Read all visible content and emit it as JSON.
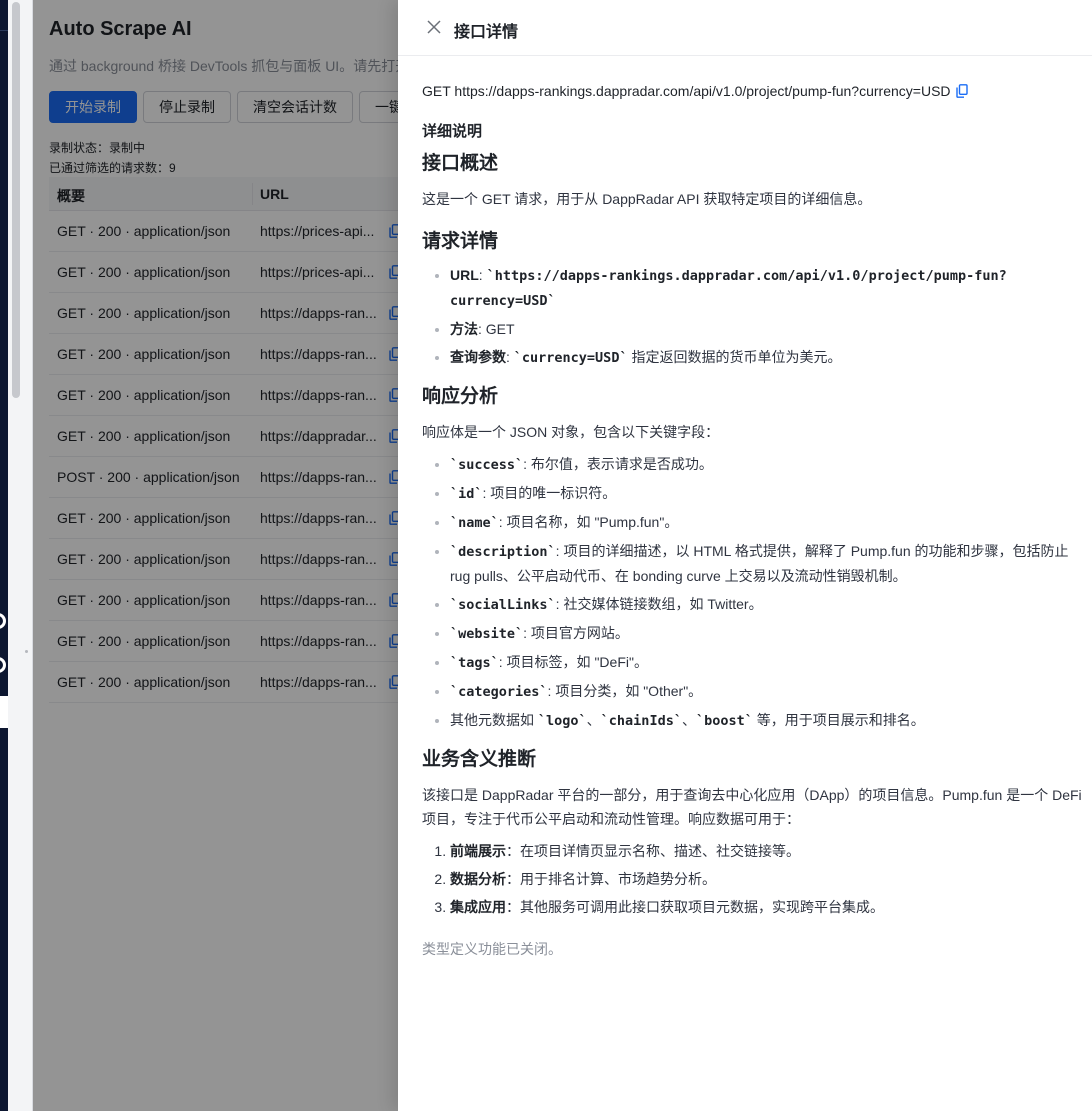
{
  "app": {
    "title": "Auto Scrape AI",
    "description": "通过 background 桥接 DevTools 抓包与面板 UI。请先打开"
  },
  "toolbar": {
    "start_label": "开始录制",
    "stop_label": "停止录制",
    "clear_label": "清空会话计数",
    "more_label": "一键"
  },
  "status": {
    "recording": "录制状态：录制中",
    "filtered": "已通过筛选的请求数：9"
  },
  "table": {
    "headers": [
      "概要",
      "URL"
    ],
    "rows": [
      {
        "summary": "GET · 200 · application/json",
        "url": "https://prices-api..."
      },
      {
        "summary": "GET · 200 · application/json",
        "url": "https://prices-api..."
      },
      {
        "summary": "GET · 200 · application/json",
        "url": "https://dapps-ran..."
      },
      {
        "summary": "GET · 200 · application/json",
        "url": "https://dapps-ran..."
      },
      {
        "summary": "GET · 200 · application/json",
        "url": "https://dapps-ran..."
      },
      {
        "summary": "GET · 200 · application/json",
        "url": "https://dappradar..."
      },
      {
        "summary": "POST · 200 · application/json",
        "url": "https://dapps-ran..."
      },
      {
        "summary": "GET · 200 · application/json",
        "url": "https://dapps-ran..."
      },
      {
        "summary": "GET · 200 · application/json",
        "url": "https://dapps-ran..."
      },
      {
        "summary": "GET · 200 · application/json",
        "url": "https://dapps-ran..."
      },
      {
        "summary": "GET · 200 · application/json",
        "url": "https://dapps-ran..."
      },
      {
        "summary": "GET · 200 · application/json",
        "url": "https://dapps-ran..."
      }
    ]
  },
  "drawer": {
    "title": "接口详情",
    "request_line": "GET https://dapps-rankings.dappradar.com/api/v1.0/project/pump-fun?currency=USD",
    "section_title": "详细说明",
    "h_overview": "接口概述",
    "p_overview": "这是一个 GET 请求，用于从 DappRadar API 获取特定项目的详细信息。",
    "h_request": "请求详情",
    "req_url_label": "URL",
    "req_url_sep": ": ",
    "req_url_code": "`https://dapps-rankings.dappradar.com/api/v1.0/project/pump-fun?currency=USD`",
    "req_method_label": "方法",
    "req_method_value": ": GET",
    "req_query_label": "查询参数",
    "req_query_sep": ": ",
    "req_query_code": "`currency=USD`",
    "req_query_desc": " 指定返回数据的货币单位为美元。",
    "h_response": "响应分析",
    "p_response": "响应体是一个 JSON 对象，包含以下关键字段：",
    "fields": [
      {
        "code": "`success`",
        "desc": ": 布尔值，表示请求是否成功。"
      },
      {
        "code": "`id`",
        "desc": ": 项目的唯一标识符。"
      },
      {
        "code": "`name`",
        "desc": ": 项目名称，如 \"Pump.fun\"。"
      },
      {
        "code": "`description`",
        "desc": ": 项目的详细描述，以 HTML 格式提供，解释了 Pump.fun 的功能和步骤，包括防止 rug pulls、公平启动代币、在 bonding curve 上交易以及流动性销毁机制。"
      },
      {
        "code": "`socialLinks`",
        "desc": ": 社交媒体链接数组，如 Twitter。"
      },
      {
        "code": "`website`",
        "desc": ": 项目官方网站。"
      },
      {
        "code": "`tags`",
        "desc": ": 项目标签，如 \"DeFi\"。"
      },
      {
        "code": "`categories`",
        "desc": ": 项目分类，如 \"Other\"。"
      }
    ],
    "other_prefix": "其他元数据如 ",
    "other_code1": "`logo`",
    "other_sep1": "、",
    "other_code2": "`chainIds`",
    "other_sep2": "、",
    "other_code3": "`boost`",
    "other_suffix": " 等，用于项目展示和排名。",
    "h_business": "业务含义推断",
    "p_business": "该接口是 DappRadar 平台的一部分，用于查询去中心化应用（DApp）的项目信息。Pump.fun 是一个 DeFi 项目，专注于代币公平启动和流动性管理。响应数据可用于：",
    "uses": [
      {
        "label": "前端展示",
        "desc": "：在项目详情页显示名称、描述、社交链接等。"
      },
      {
        "label": "数据分析",
        "desc": "：用于排名计算、市场趋势分析。"
      },
      {
        "label": "集成应用",
        "desc": "：其他服务可调用此接口获取项目元数据，实现跨平台集成。"
      }
    ],
    "type_note": "类型定义功能已关闭。"
  },
  "colors": {
    "primary": "#1a6cf5",
    "overlay": "rgba(0,0,0,0.42)",
    "sidebar_dark": "#0c1630"
  }
}
